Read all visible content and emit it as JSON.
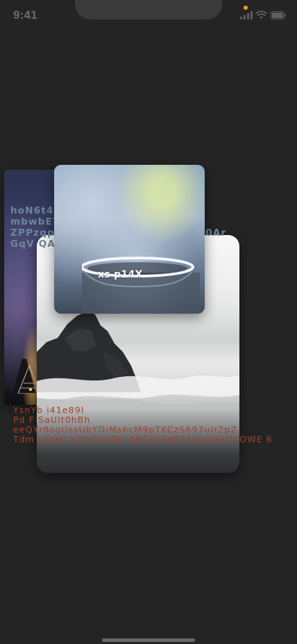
{
  "status_bar": {
    "time": "9:41",
    "dot_color": "#f0a01c",
    "icons": [
      "signal-icon",
      "wifi-icon",
      "battery-icon"
    ]
  },
  "cards": {
    "night": {
      "image": "night-city-photo"
    },
    "beach": {
      "image": "beach-rock-photo"
    },
    "cup": {
      "image": "steaming-cup-photo",
      "label": "xs p14X"
    }
  },
  "overlay_blue": {
    "lines": [
      "hoN6t4yO4Ag iN EFMe14lZ0u0g",
      "mbwbEThnXDn4N3o2NHsfls3c",
      " ZPPzqphm1AGE e2DNHonuoWTf 0Ar",
      "GqV QAIVlp"
    ],
    "color": "#6f8699"
  },
  "overlay_red": {
    "lines": [
      "YsnYb i41e89I",
      " Pd  F  SaUlt0hBh",
      "eeQYr8sqUssUbYDiMs6cM9pTKCzS697ulr2pZ",
      "Tdm  u4QxLXZCOULZM hRGbT8sBP4NoMeYDXOWE 6"
    ],
    "color": "#a0432d"
  },
  "colors": {
    "background": "#242424",
    "time_text": "#6c6c6c",
    "home_indicator": "#6a6a6a"
  }
}
